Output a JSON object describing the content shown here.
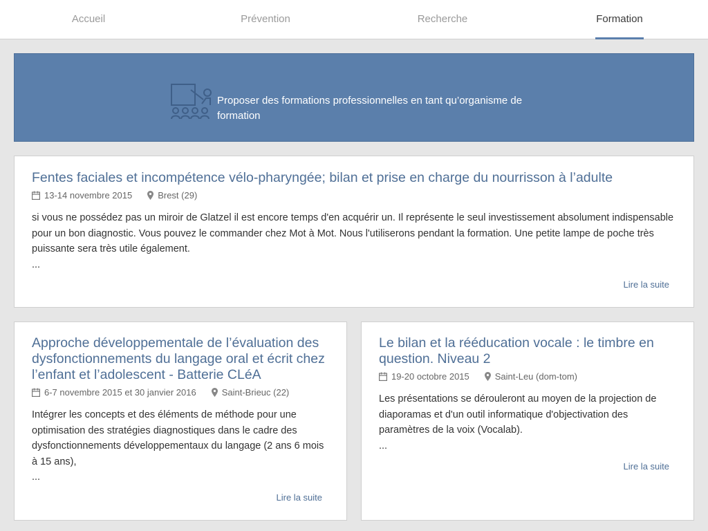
{
  "nav": {
    "tabs": [
      {
        "label": "Accueil",
        "active": false
      },
      {
        "label": "Prévention",
        "active": false
      },
      {
        "label": "Recherche",
        "active": false
      },
      {
        "label": "Formation",
        "active": true
      }
    ]
  },
  "banner": {
    "text": "Proposer des formations professionnelles en tant qu’organisme de formation",
    "icon": "classroom-icon",
    "background": "#5b7fab"
  },
  "articles": [
    {
      "title": "Fentes faciales et incompétence vélo-pharyngée; bilan et prise en charge du nourrisson à l’adulte",
      "date": "13-14 novembre 2015",
      "place": "Brest (29)",
      "description": "si vous ne possédez pas un miroir de Glatzel il est encore temps d'en acquérir un. Il représente le seul investissement absolument indispensable pour un bon diagnostic. Vous pouvez le commander chez Mot à Mot. Nous l'utiliserons pendant la formation. Une petite lampe de poche très puissante sera très utile également.",
      "ellipsis": "...",
      "more": "Lire la suite"
    },
    {
      "title": "Approche développementale de l’évaluation des dysfonctionnements du langage oral et écrit chez l’enfant et l’adolescent - Batterie CLéA",
      "date": "6-7 novembre 2015 et 30 janvier 2016",
      "place": "Saint-Brieuc (22)",
      "description": "Intégrer les concepts et des éléments de méthode pour une optimisation des stratégies diagnostiques dans le cadre des dysfonctionnements développementaux du langage (2 ans 6 mois à 15 ans),",
      "ellipsis": "...",
      "more": "Lire la suite"
    },
    {
      "title": "Le bilan et la rééducation vocale : le timbre en question. Niveau 2",
      "date": "19-20 octobre 2015",
      "place": "Saint-Leu (dom-tom)",
      "description": "Les présentations se dérouleront au moyen de la projection de diaporamas et d'un outil informatique d'objectivation des paramètres de la voix (Vocalab).",
      "ellipsis": "...",
      "more": "Lire la suite"
    }
  ],
  "colors": {
    "accent": "#4f6f96",
    "page_background": "#e6e6e6"
  }
}
